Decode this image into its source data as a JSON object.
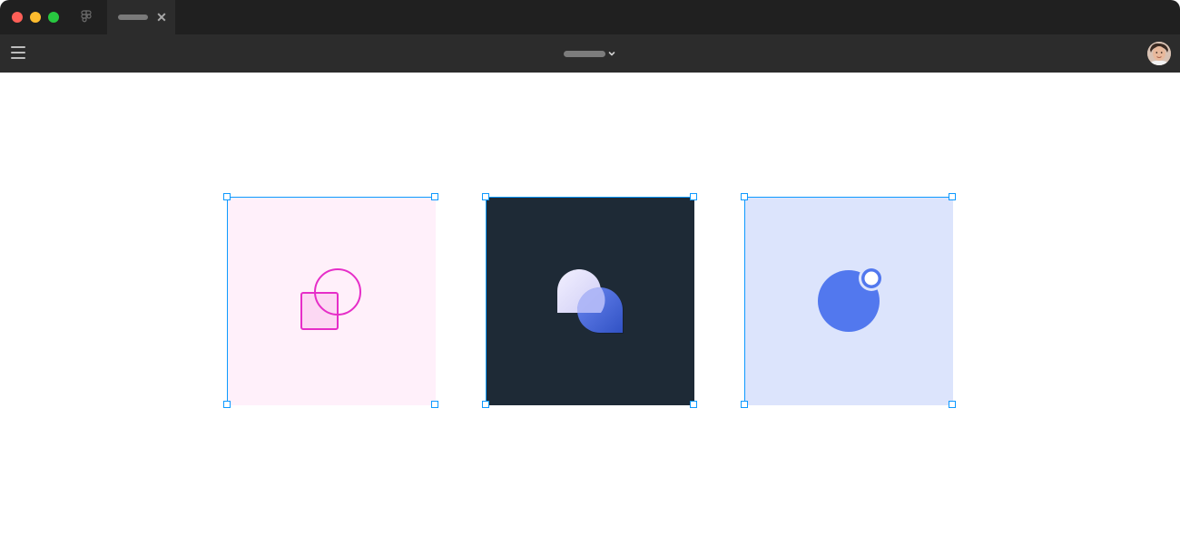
{
  "window": {
    "tab": {
      "title": "",
      "close_glyph": "✕"
    },
    "file": {
      "name": ""
    },
    "icons": {
      "app": "figma-icon",
      "menu": "hamburger-menu-icon",
      "chevron": "chevron-down-icon",
      "avatar": "user-avatar"
    }
  },
  "canvas": {
    "frames": [
      {
        "name": "shapes-frame",
        "background": "#fff0fa",
        "accent": "#e62ec8"
      },
      {
        "name": "blobs-frame",
        "background": "#1e2a36",
        "accent": "#4a6ee8"
      },
      {
        "name": "notification-frame",
        "background": "#dce4fc",
        "accent": "#5278ee"
      }
    ],
    "selection_color": "#0d99ff"
  }
}
